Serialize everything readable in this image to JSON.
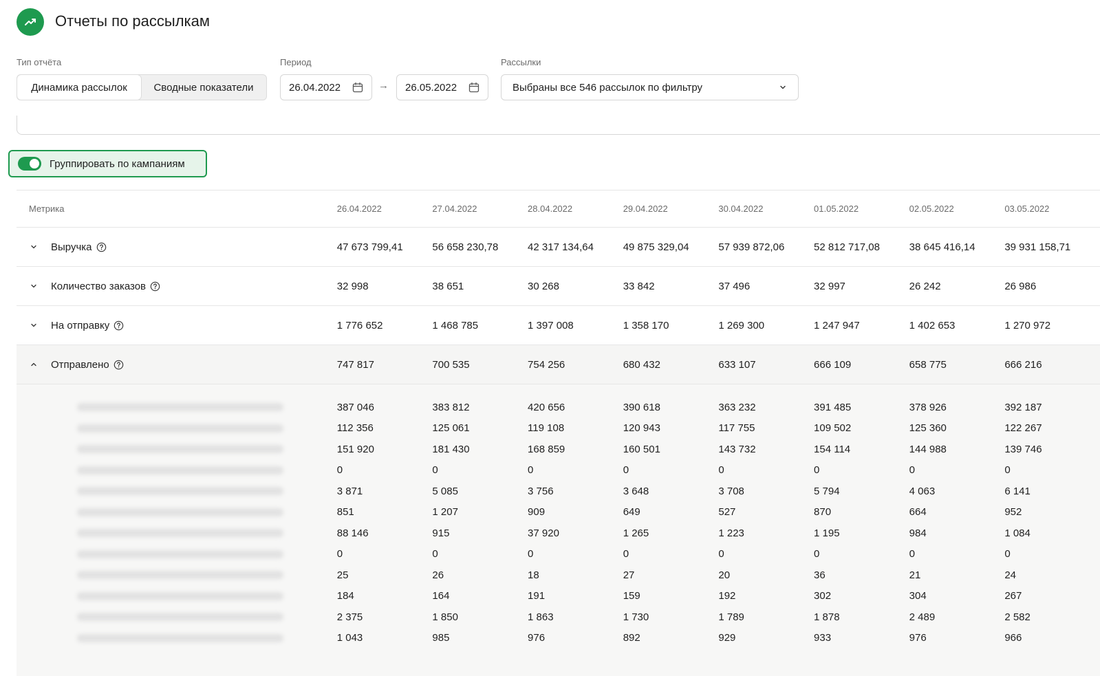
{
  "header": {
    "title": "Отчеты по рассылкам",
    "icon": "trending-up-icon",
    "brand_color": "#1e9a4f"
  },
  "filters": {
    "report_type_label": "Тип отчёта",
    "report_types": [
      "Динамика рассылок",
      "Сводные показатели"
    ],
    "period_label": "Период",
    "date_from": "26.04.2022",
    "date_to": "26.05.2022",
    "mailings_label": "Рассылки",
    "mailings_value": "Выбраны все 546 рассылок по фильтру"
  },
  "toggle": {
    "label": "Группировать по кампаниям",
    "on": true
  },
  "table": {
    "metric_header": "Метрика",
    "dates": [
      "26.04.2022",
      "27.04.2022",
      "28.04.2022",
      "29.04.2022",
      "30.04.2022",
      "01.05.2022",
      "02.05.2022",
      "03.05.2022"
    ],
    "metrics": [
      {
        "name": "Выручка",
        "expanded": false,
        "values": [
          "47 673 799,41",
          "56 658 230,78",
          "42 317 134,64",
          "49 875 329,04",
          "57 939 872,06",
          "52 812 717,08",
          "38 645 416,14",
          "39 931 158,71"
        ]
      },
      {
        "name": "Количество заказов",
        "expanded": false,
        "values": [
          "32 998",
          "38 651",
          "30 268",
          "33 842",
          "37 496",
          "32 997",
          "26 242",
          "26 986"
        ]
      },
      {
        "name": "На отправку",
        "expanded": false,
        "values": [
          "1 776 652",
          "1 468 785",
          "1 397 008",
          "1 358 170",
          "1 269 300",
          "1 247 947",
          "1 402 653",
          "1 270 972"
        ]
      },
      {
        "name": "Отправлено",
        "expanded": true,
        "values": [
          "747 817",
          "700 535",
          "754 256",
          "680 432",
          "633 107",
          "666 109",
          "658 775",
          "666 216"
        ]
      }
    ],
    "sub_rows": [
      [
        "387 046",
        "383 812",
        "420 656",
        "390 618",
        "363 232",
        "391 485",
        "378 926",
        "392 187"
      ],
      [
        "112 356",
        "125 061",
        "119 108",
        "120 943",
        "117 755",
        "109 502",
        "125 360",
        "122 267"
      ],
      [
        "151 920",
        "181 430",
        "168 859",
        "160 501",
        "143 732",
        "154 114",
        "144 988",
        "139 746"
      ],
      [
        "0",
        "0",
        "0",
        "0",
        "0",
        "0",
        "0",
        "0"
      ],
      [
        "3 871",
        "5 085",
        "3 756",
        "3 648",
        "3 708",
        "5 794",
        "4 063",
        "6 141"
      ],
      [
        "851",
        "1 207",
        "909",
        "649",
        "527",
        "870",
        "664",
        "952"
      ],
      [
        "88 146",
        "915",
        "37 920",
        "1 265",
        "1 223",
        "1 195",
        "984",
        "1 084"
      ],
      [
        "0",
        "0",
        "0",
        "0",
        "0",
        "0",
        "0",
        "0"
      ],
      [
        "25",
        "26",
        "18",
        "27",
        "20",
        "36",
        "21",
        "24"
      ],
      [
        "184",
        "164",
        "191",
        "159",
        "192",
        "302",
        "304",
        "267"
      ],
      [
        "2 375",
        "1 850",
        "1 863",
        "1 730",
        "1 789",
        "1 878",
        "2 489",
        "2 582"
      ],
      [
        "1 043",
        "985",
        "976",
        "892",
        "929",
        "933",
        "976",
        "966"
      ]
    ]
  }
}
